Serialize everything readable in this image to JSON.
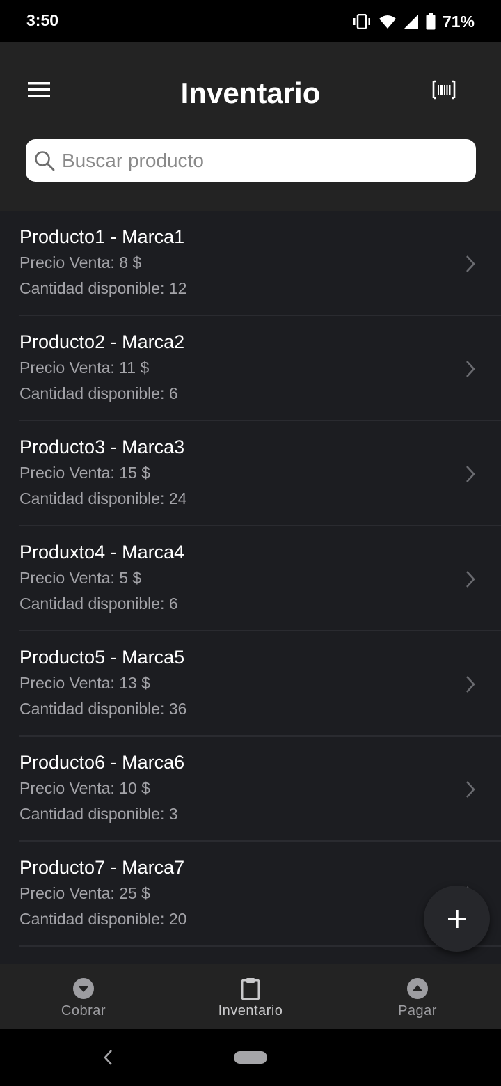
{
  "status_bar": {
    "time": "3:50",
    "battery": "71%",
    "icons": [
      "vibrate-icon",
      "wifi-icon",
      "signal-icon",
      "battery-icon"
    ]
  },
  "app_bar": {
    "title": "Inventario",
    "menu_icon": "menu-icon",
    "action_icon": "barcode-scan-icon"
  },
  "search": {
    "placeholder": "Buscar producto",
    "value": ""
  },
  "products": [
    {
      "title": "Producto1 - Marca1",
      "price": "Precio Venta: 8 $",
      "quantity": "Cantidad disponible: 12"
    },
    {
      "title": "Producto2 - Marca2",
      "price": "Precio Venta: 11 $",
      "quantity": "Cantidad disponible: 6"
    },
    {
      "title": "Producto3 - Marca3",
      "price": "Precio Venta: 15 $",
      "quantity": "Cantidad disponible: 24"
    },
    {
      "title": "Produxto4 - Marca4",
      "price": "Precio Venta: 5 $",
      "quantity": "Cantidad disponible: 6"
    },
    {
      "title": "Producto5 - Marca5",
      "price": "Precio Venta: 13 $",
      "quantity": "Cantidad disponible: 36"
    },
    {
      "title": "Producto6 - Marca6",
      "price": "Precio Venta: 10 $",
      "quantity": "Cantidad disponible: 3"
    },
    {
      "title": "Producto7 - Marca7",
      "price": "Precio Venta: 25 $",
      "quantity": "Cantidad disponible: 20"
    }
  ],
  "fab": {
    "icon": "plus-icon"
  },
  "bottom_nav": {
    "items": [
      {
        "label": "Cobrar",
        "icon": "arrow-down-circle-icon"
      },
      {
        "label": "Inventario",
        "icon": "clipboard-icon"
      },
      {
        "label": "Pagar",
        "icon": "arrow-up-circle-icon"
      }
    ],
    "active": "Inventario"
  },
  "colors": {
    "background": "#1c1d21",
    "app_bar": "#232323",
    "search_bg": "#ffffff",
    "secondary_text": "#a3a3a8"
  }
}
